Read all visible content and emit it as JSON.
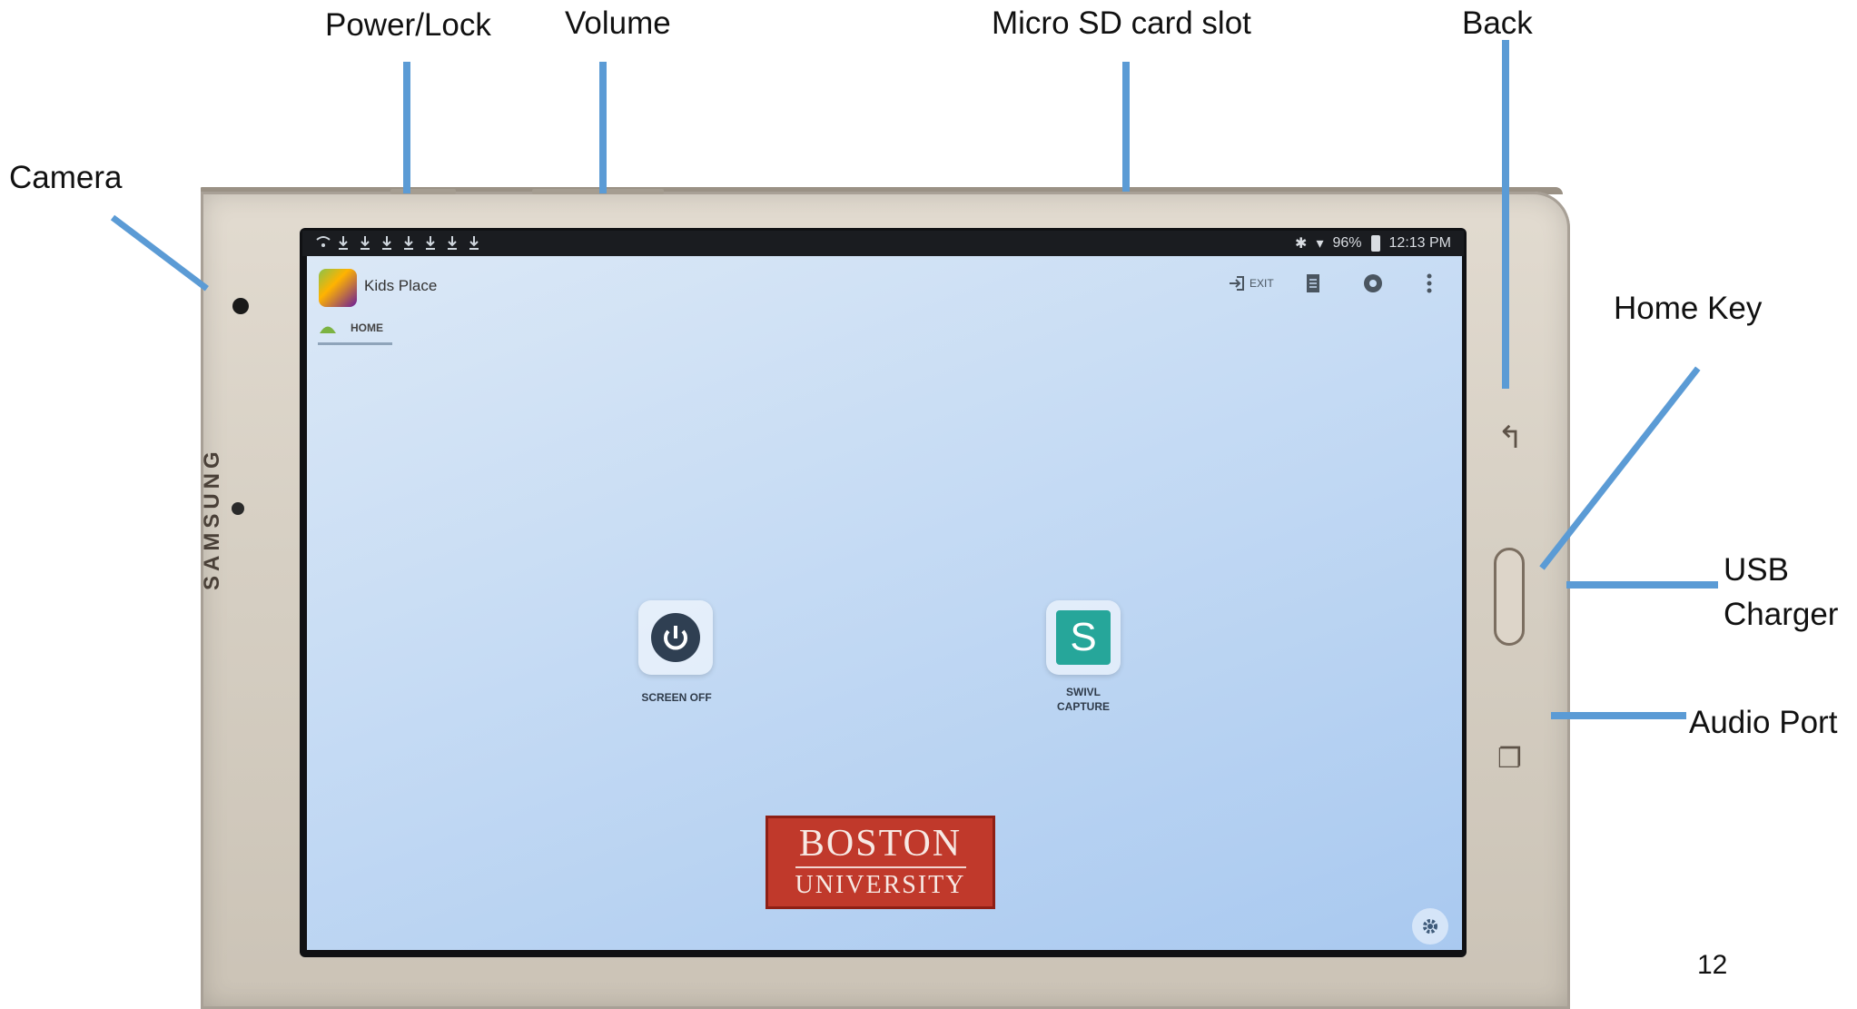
{
  "callouts": {
    "power_lock": "Power/Lock",
    "volume": "Volume",
    "micro_sd": "Micro SD card slot",
    "back": "Back",
    "camera": "Camera",
    "home_key": "Home Key",
    "usb_charger_line1": "USB",
    "usb_charger_line2": "Charger",
    "audio_port": "Audio Port"
  },
  "device": {
    "brand": "SAMSUNG"
  },
  "status_bar": {
    "battery": "96%",
    "time": "12:13 PM"
  },
  "app": {
    "title": "Kids Place",
    "tab_home": "HOME",
    "toolbar_exit": "EXIT"
  },
  "tiles": {
    "screen_off": "SCREEN OFF",
    "swivl_line1": "SWIVL",
    "swivl_line2": "CAPTURE",
    "swivl_letter": "S"
  },
  "logo": {
    "line1": "BOSTON",
    "line2": "UNIVERSITY"
  },
  "page_number": "12",
  "colors": {
    "leader_lines": "#5b9bd5",
    "screen_background": "#c7dcf4",
    "logo_red": "#c0392b",
    "swivl_teal": "#26a69a"
  }
}
